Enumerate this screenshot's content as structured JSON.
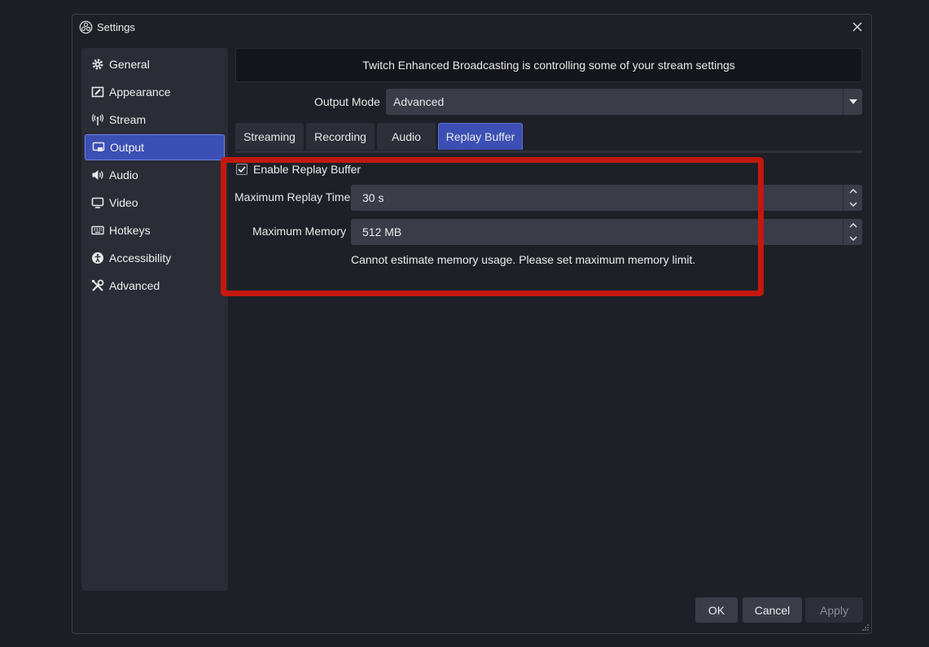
{
  "window": {
    "title": "Settings"
  },
  "sidebar": {
    "items": [
      {
        "label": "General",
        "icon": "gear-icon",
        "selected": false
      },
      {
        "label": "Appearance",
        "icon": "appearance-icon",
        "selected": false
      },
      {
        "label": "Stream",
        "icon": "antenna-icon",
        "selected": false
      },
      {
        "label": "Output",
        "icon": "output-icon",
        "selected": true
      },
      {
        "label": "Audio",
        "icon": "speaker-icon",
        "selected": false
      },
      {
        "label": "Video",
        "icon": "monitor-icon",
        "selected": false
      },
      {
        "label": "Hotkeys",
        "icon": "keyboard-icon",
        "selected": false
      },
      {
        "label": "Accessibility",
        "icon": "accessibility-icon",
        "selected": false
      },
      {
        "label": "Advanced",
        "icon": "tools-icon",
        "selected": false
      }
    ]
  },
  "banner": {
    "text": "Twitch Enhanced Broadcasting is controlling some of your stream settings"
  },
  "output_mode": {
    "label": "Output Mode",
    "value": "Advanced"
  },
  "tabs": [
    {
      "label": "Streaming",
      "active": false
    },
    {
      "label": "Recording",
      "active": false
    },
    {
      "label": "Audio",
      "active": false
    },
    {
      "label": "Replay Buffer",
      "active": true
    }
  ],
  "replay": {
    "enable_label": "Enable Replay Buffer",
    "enabled": true,
    "max_time_label": "Maximum Replay Time",
    "max_time_value": "30 s",
    "max_memory_label": "Maximum Memory",
    "max_memory_value": "512 MB",
    "warning": "Cannot estimate memory usage. Please set maximum memory limit."
  },
  "buttons": {
    "ok": "OK",
    "cancel": "Cancel",
    "apply": "Apply"
  },
  "colors": {
    "accent": "#3b4fb4",
    "highlight": "#c4180f",
    "background": "#1f2027"
  }
}
